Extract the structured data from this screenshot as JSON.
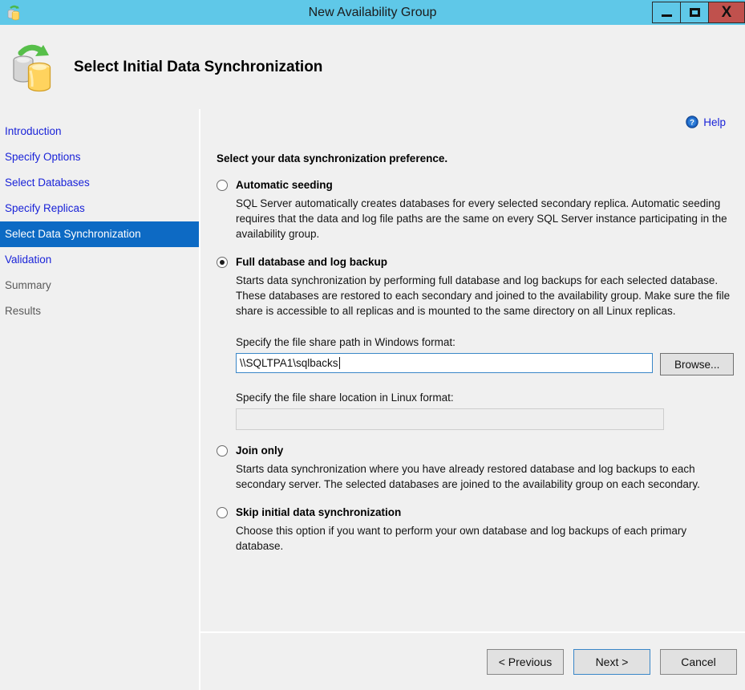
{
  "window": {
    "title": "New Availability Group",
    "icon": "database-sync-icon",
    "controls": {
      "minimize": "minimize-icon",
      "maximize": "maximize-icon",
      "close": "X"
    }
  },
  "header": {
    "icon": "database-sync-icon",
    "title": "Select Initial Data Synchronization"
  },
  "sidebar": {
    "items": [
      {
        "label": "Introduction",
        "state": "link"
      },
      {
        "label": "Specify Options",
        "state": "link"
      },
      {
        "label": "Select Databases",
        "state": "link"
      },
      {
        "label": "Specify Replicas",
        "state": "link"
      },
      {
        "label": "Select Data Synchronization",
        "state": "active"
      },
      {
        "label": "Validation",
        "state": "link"
      },
      {
        "label": "Summary",
        "state": "disabled"
      },
      {
        "label": "Results",
        "state": "disabled"
      }
    ]
  },
  "content": {
    "help": {
      "label": "Help",
      "icon": "help-question-icon"
    },
    "heading": "Select your data synchronization preference.",
    "options": [
      {
        "id": "automatic-seeding",
        "label": "Automatic seeding",
        "selected": false,
        "description": "SQL Server automatically creates databases for every selected secondary replica. Automatic seeding requires that the data and log file paths are the same on every SQL Server instance participating in the availability group."
      },
      {
        "id": "full-database-and-log-backup",
        "label": "Full database and log backup",
        "selected": true,
        "description": "Starts data synchronization by performing full database and log backups for each selected database. These databases are restored to each secondary and joined to the availability group. Make sure the file share is accessible to all replicas and is mounted to the same directory on all Linux replicas."
      },
      {
        "id": "join-only",
        "label": "Join only",
        "selected": false,
        "description": "Starts data synchronization where you have already restored database and log backups to each secondary server. The selected databases are joined to the availability group on each secondary."
      },
      {
        "id": "skip-initial-data-synchronization",
        "label": "Skip initial data synchronization",
        "selected": false,
        "description": "Choose this option if you want to perform your own database and log backups of each primary database."
      }
    ],
    "windows_share": {
      "label": "Specify the file share path in Windows format:",
      "value": "\\\\SQLTPA1\\sqlbacks",
      "placeholder": "",
      "browse_label": "Browse..."
    },
    "linux_share": {
      "label": "Specify the file share location in Linux format:",
      "value": "",
      "placeholder": "",
      "disabled": true
    }
  },
  "footer": {
    "previous_label": "< Previous",
    "next_label": "Next >",
    "cancel_label": "Cancel"
  },
  "colors": {
    "titlebar": "#5fc8e8",
    "close_button": "#c0514d",
    "accent_link": "#1a23d8",
    "active_nav": "#0d6ac4",
    "panel_bg": "#f0f0f0",
    "focus_border": "#3a87c8"
  }
}
